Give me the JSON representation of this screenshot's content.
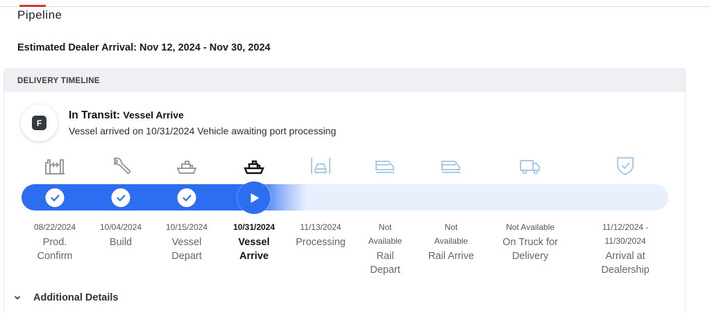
{
  "header": {
    "title": "Pipeline"
  },
  "arrival": {
    "label": "Estimated Dealer Arrival:",
    "value": "Nov 12, 2024 - Nov 30, 2024"
  },
  "timeline": {
    "title": "DELIVERY TIMELINE",
    "avatar_letter": "F",
    "status_prefix": "In Transit:",
    "status_stage": "Vessel Arrive",
    "status_description": "Vessel arrived on 10/31/2024 Vehicle awaiting port processing",
    "stages": [
      {
        "date": "08/22/2024",
        "label": "Prod. Confirm",
        "state": "complete",
        "icon": "factory-icon"
      },
      {
        "date": "10/04/2024",
        "label": "Build",
        "state": "complete",
        "icon": "wrench-icon"
      },
      {
        "date": "10/15/2024",
        "label": "Vessel Depart",
        "state": "complete",
        "icon": "ship-icon"
      },
      {
        "date": "10/31/2024",
        "label": "Vessel Arrive",
        "state": "current",
        "icon": "ship-icon"
      },
      {
        "date": "11/13/2024",
        "label": "Processing",
        "state": "pending",
        "icon": "car-garage-icon"
      },
      {
        "date": "Not Available",
        "label": "Rail Depart",
        "state": "pending",
        "icon": "train-icon"
      },
      {
        "date": "Not Available",
        "label": "Rail Arrive",
        "state": "pending",
        "icon": "train-icon"
      },
      {
        "date": "Not Available",
        "label": "On Truck for Delivery",
        "state": "pending",
        "icon": "truck-icon"
      },
      {
        "date": "11/12/2024 - 11/30/2024",
        "label": "Arrival at Dealership",
        "state": "pending",
        "icon": "shield-check-icon"
      }
    ],
    "colors": {
      "progress": "#2d6ef0",
      "track": "#e8effd",
      "complete_icon": "#9a9a9a",
      "pending_icon": "#a9cbe8",
      "current_icon": "#111111"
    }
  },
  "additional_details": {
    "label": "Additional Details"
  }
}
